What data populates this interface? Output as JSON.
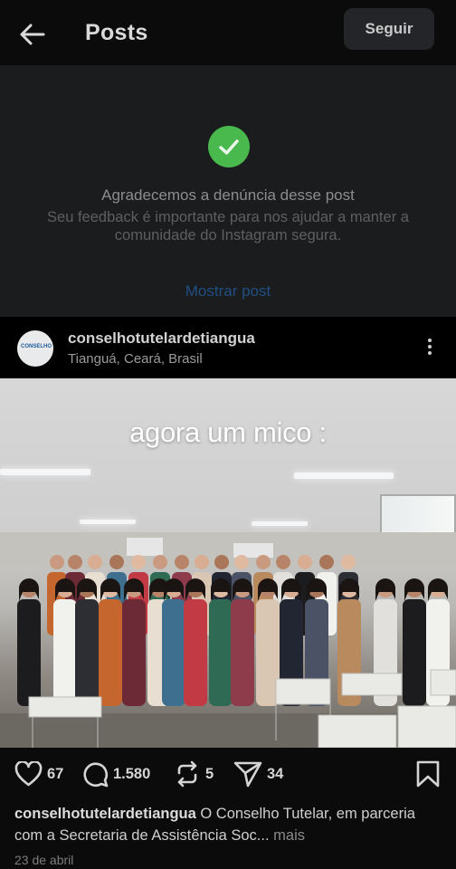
{
  "header": {
    "title": "Posts",
    "follow_label": "Seguir"
  },
  "report": {
    "title": "Agradecemos a denúncia desse post",
    "description": "Seu feedback é importante para nos ajudar a manter a comunidade do Instagram segura.",
    "show_post_label": "Mostrar post",
    "check_color": "#49b84d",
    "link_color": "#1f4f83"
  },
  "post": {
    "author": "conselhotutelardetiangua",
    "location": "Tianguá, Ceará, Brasil",
    "avatar_logo_text": "CONSELHO",
    "overlay_text": "agora um mico :",
    "likes": "67",
    "comments": "1.580",
    "reposts": "5",
    "shares": "34",
    "caption_user": "conselhotutelardetiangua",
    "caption_text": "O Conselho Tutelar, em parceria com a Secretaria de Assistência Soc...",
    "caption_more": "mais",
    "date": "23 de abril"
  },
  "icons": {
    "back": "arrow-left-icon",
    "check": "check-icon",
    "more": "more-vertical-icon",
    "like": "heart-icon",
    "comment": "comment-icon",
    "repost": "repost-icon",
    "share": "send-icon",
    "save": "bookmark-icon"
  }
}
